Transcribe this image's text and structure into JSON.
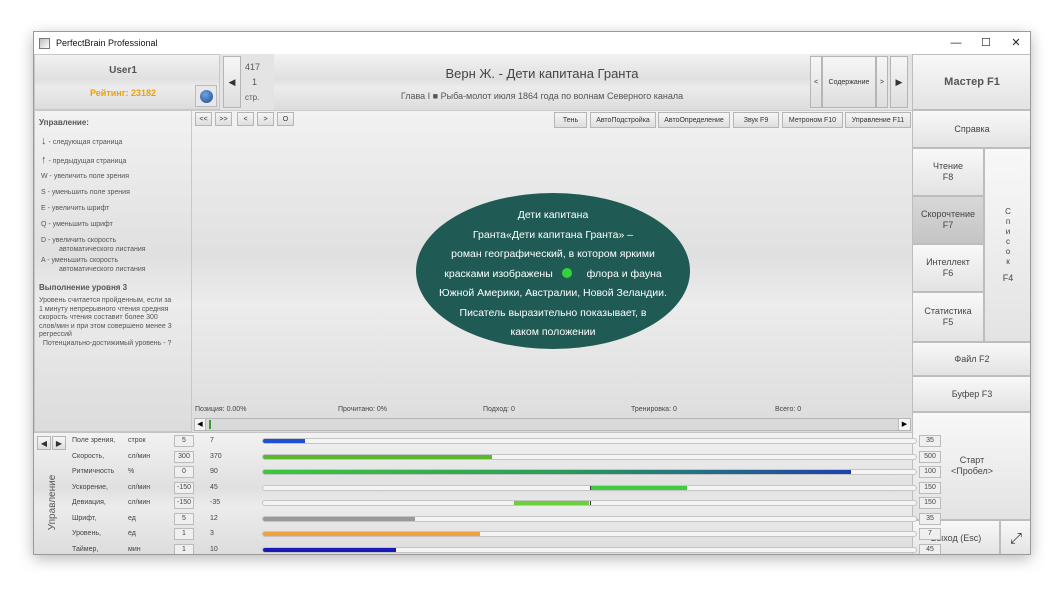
{
  "window": {
    "title": "PerfectBrain Professional",
    "minimize": "—",
    "maximize": "☐",
    "close": "✕"
  },
  "user": {
    "name": "User1",
    "rating": "Рейтинг: 23182"
  },
  "page_nav": {
    "page_number": "417",
    "sub_number": "1",
    "page_label": "стр."
  },
  "book": {
    "title": "Верн Ж. - Дети капитана Гранта",
    "chapter": "Глава I  ■  Рыба-молот июля 1864 года по волнам Северного канала"
  },
  "toc": {
    "prev": "<",
    "label": "Содержание",
    "next": ">"
  },
  "master": "Мастер F1",
  "nav_buttons": [
    "<<",
    ">>",
    "<",
    ">",
    "O"
  ],
  "toolbar": [
    "Тень",
    "АвтоПодстройка",
    "АвтоОпределение",
    "Звук F9",
    "Метроном F10",
    "Управление F11"
  ],
  "controls": {
    "heading": "Управление:",
    "items": [
      "- следующая страница",
      "- предыдущая страница",
      "W  - увеличить поле зрения",
      "S  - уменьшить поле зрения",
      "E  - увеличить шрифт",
      "Q  - уменьшить шрифт",
      "D  - увеличить скорость",
      "автоматического листания",
      "A  - уменьшить скорость",
      "автоматического листания"
    ]
  },
  "level": {
    "heading": "Выполнение уровня 3",
    "text": [
      "Уровень считается пройденным, если за",
      "1 минуту непрерывного чтения средняя",
      "скорость чтения составит более 300",
      "слов/мин и при этом совершено менее 3",
      "регрессий",
      "  Потенциально-достижимый уровень - ?"
    ]
  },
  "reading_text": [
    "Дети капитана",
    "Гранта«Дети капитана Гранта» –",
    "роман географический, в котором яркими",
    "красками изображены",
    "флора и фауна",
    "Южной Америки, Австралии, Новой Зеландии.",
    "Писатель выразительно показывает, в",
    "каком положении"
  ],
  "status": {
    "position": "Позиция: 0.00%",
    "read": "Прочитано: 0%",
    "approach": "Подход: 0",
    "training": "Тренировка: 0",
    "total": "Всего: 0"
  },
  "side_menu": {
    "help": "Справка",
    "reading": [
      "Чтение",
      "F8"
    ],
    "speed": [
      "Скорочтение",
      "F7"
    ],
    "intellect": [
      "Интеллект",
      "F6"
    ],
    "stats": [
      "Статистика",
      "F5"
    ],
    "list_letters": [
      "С",
      "п",
      "и",
      "с",
      "о",
      "к"
    ],
    "list_key": "F4",
    "file": "Файл F2",
    "buffer": "Буфер F3",
    "start": [
      "Старт",
      "<Пробел>"
    ],
    "exit": "Выход (Esc)"
  },
  "control_panel_label": "Управление",
  "params": [
    {
      "name": "Поле зрения,",
      "unit": "строк",
      "min": "5",
      "value": "7",
      "max": "35",
      "fill_start": 0.0,
      "fill_end": 0.065,
      "color": "#1d4fd8"
    },
    {
      "name": "Скорость,",
      "unit": "сл/мин",
      "min": "300",
      "value": "370",
      "max": "500",
      "fill_start": 0.0,
      "fill_end": 0.35,
      "color": "#5bb82e"
    },
    {
      "name": "Ритмичность",
      "unit": "%",
      "min": "0",
      "value": "90",
      "max": "100",
      "fill_start": 0.0,
      "fill_end": 0.9,
      "color": "#2a9d5a"
    },
    {
      "name": "Ускорение,",
      "unit": "сл/мин",
      "min": "-150",
      "value": "45",
      "max": "150",
      "fill_start": 0.5,
      "fill_end": 0.65,
      "color": "#3fcc3f"
    },
    {
      "name": "Девиация,",
      "unit": "сл/мин",
      "min": "-150",
      "value": "-35",
      "max": "150",
      "fill_start": 0.385,
      "fill_end": 0.5,
      "color": "#6ad13a"
    },
    {
      "name": "Шрифт,",
      "unit": "ед",
      "min": "5",
      "value": "12",
      "max": "35",
      "fill_start": 0.0,
      "fill_end": 0.233,
      "color": "#9a9a9a"
    },
    {
      "name": "Уровень,",
      "unit": "ед",
      "min": "1",
      "value": "3",
      "max": "7",
      "fill_start": 0.0,
      "fill_end": 0.333,
      "color": "#f0a040"
    },
    {
      "name": "Таймер,",
      "unit": "мин",
      "min": "1",
      "value": "10",
      "max": "45",
      "fill_start": 0.0,
      "fill_end": 0.204,
      "color": "#1a1ab8"
    }
  ]
}
